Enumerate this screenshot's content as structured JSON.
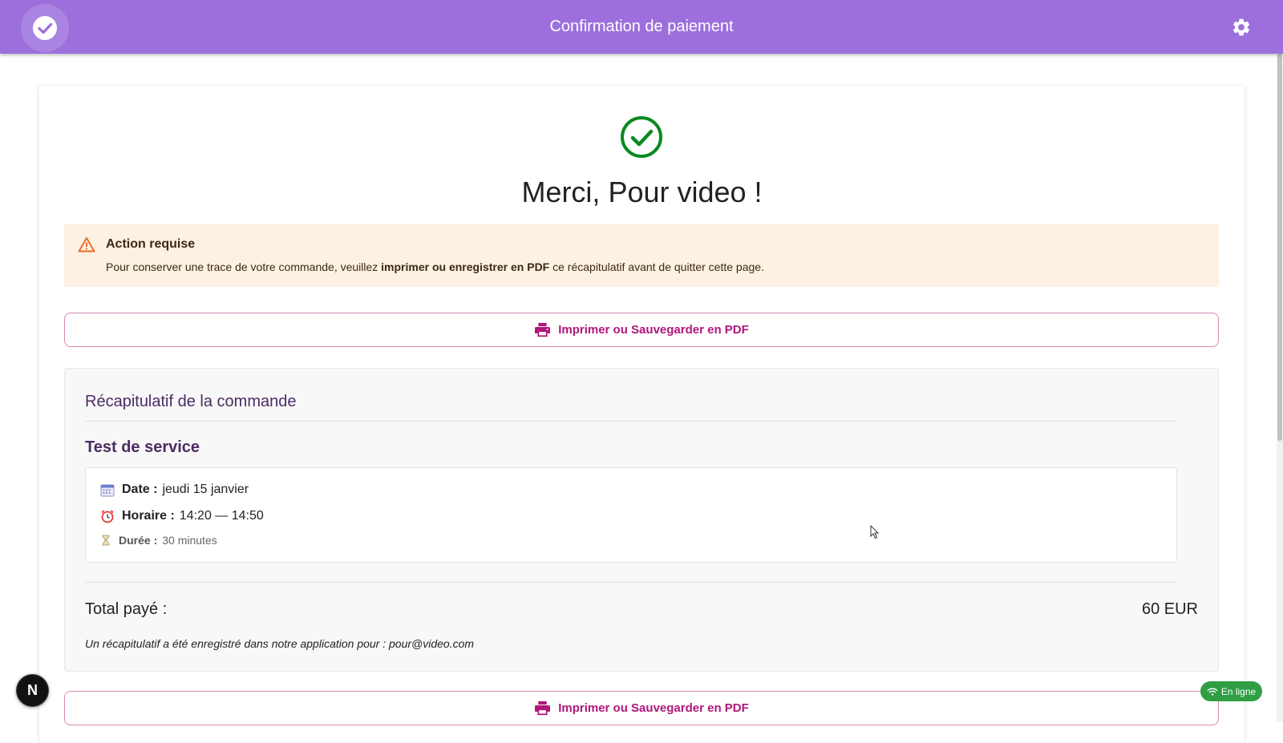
{
  "header": {
    "title": "Confirmation de paiement",
    "icons": [
      "check-circle-icon",
      "gear-icon"
    ],
    "color": "#9c6fdc"
  },
  "confirmation": {
    "heading": "Merci, Pour video !",
    "icon": "success-check-icon",
    "color": "#0a8a1f"
  },
  "alert": {
    "title": "Action requise",
    "message_before": "Pour conserver une trace de votre commande, veuillez ",
    "message_bold": "imprimer ou enregistrer en PDF",
    "message_after": " ce récapitulatif avant de quitter cette page.",
    "icon": "warning-icon"
  },
  "print_button": {
    "label": "Imprimer ou Sauvegarder en PDF",
    "icon": "printer-icon",
    "color": "#b0167a"
  },
  "summary": {
    "title": "Récapitulatif de la commande",
    "service_name": "Test de service",
    "details": {
      "date_label": "Date :",
      "date_value": "jeudi 15 janvier",
      "time_label": "Horaire :",
      "time_value": "14:20 — 14:50",
      "duration_label": "Durée :",
      "duration_value": "30 minutes"
    },
    "total_label": "Total payé :",
    "total_value": "60 EUR",
    "note": "Un récapitulatif a été enregistré dans notre application pour : pour@video.com"
  },
  "badges": {
    "n_badge": "N",
    "online": "En ligne"
  }
}
